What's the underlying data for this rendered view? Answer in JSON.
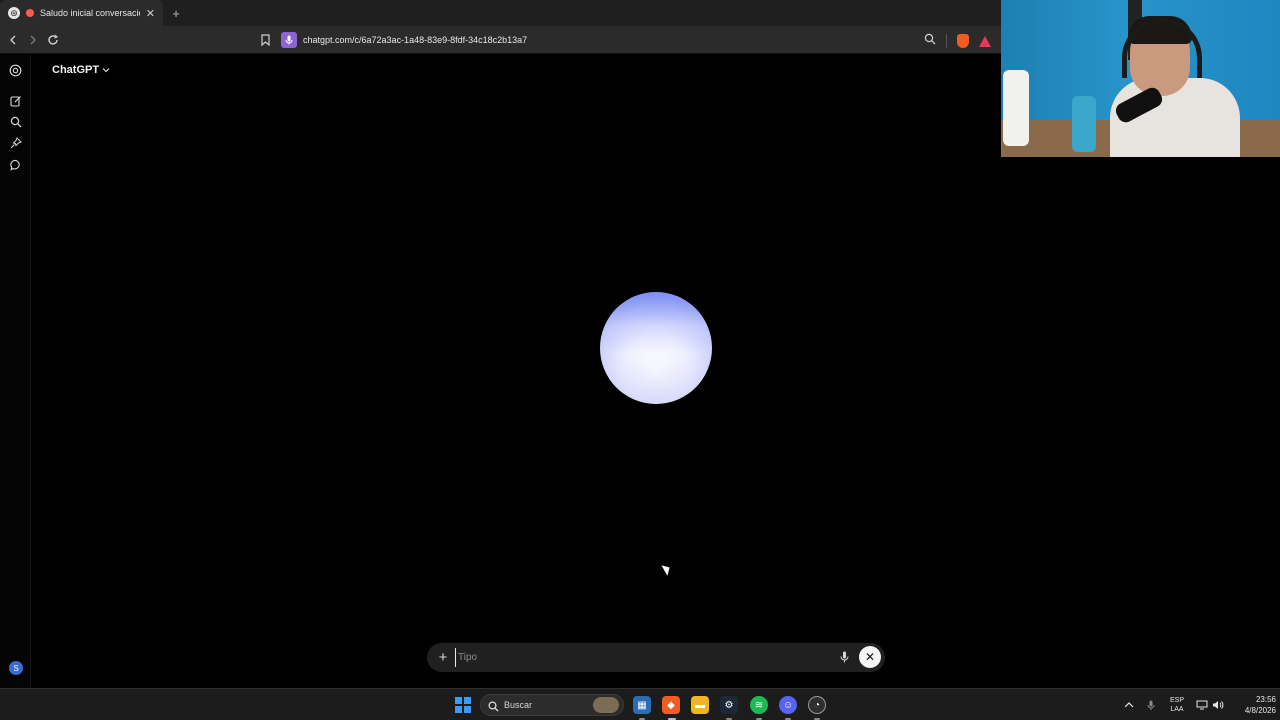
{
  "browser": {
    "tab_title": "Saludo inicial conversación",
    "url": "chatgpt.com/c/6a72a3ac-1a48-83e9-8fdf-34c18c2b13a7"
  },
  "app": {
    "model_title": "ChatGPT",
    "avatar_initial": "S"
  },
  "composer": {
    "placeholder": "Tipo",
    "value": ""
  },
  "taskbar": {
    "search_label": "Buscar",
    "lang_top": "ESP",
    "lang_bottom": "LAA",
    "time": "23:56",
    "date": "4/8/2026"
  },
  "colors": {
    "accent_blue": "#3b6ad4",
    "mic_chip": "#8e63d4",
    "brave": "#f25c23"
  }
}
